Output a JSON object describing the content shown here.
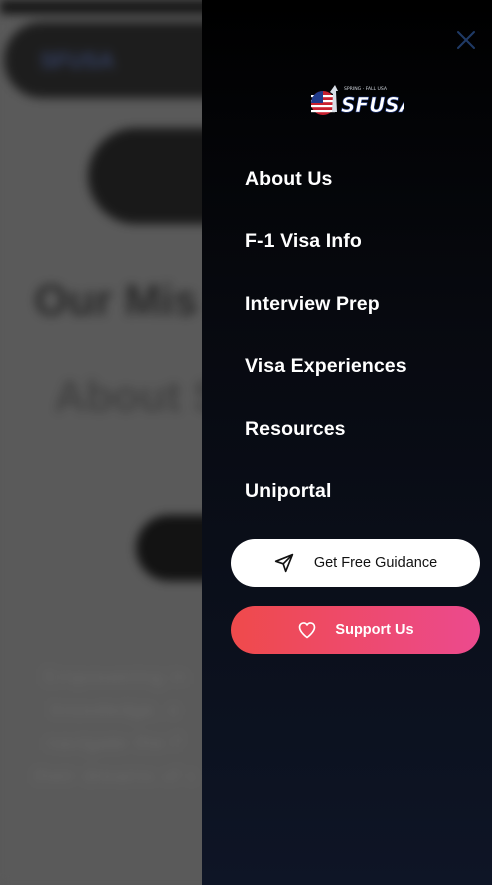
{
  "background": {
    "logo_text": "SFUSA",
    "heading_1": "Our Mis",
    "heading_2": "About S",
    "paragraph_lines": [
      "Empowering in",
      "knowledge, e",
      "navigate the F",
      "their dreams of s"
    ]
  },
  "drawer": {
    "close_icon": "close-icon",
    "brand": {
      "name": "SFUSA",
      "tagline": "SPRING · FALL USA"
    },
    "nav_items": [
      {
        "label": "About Us"
      },
      {
        "label": "F-1 Visa Info"
      },
      {
        "label": "Interview Prep"
      },
      {
        "label": "Visa Experiences"
      },
      {
        "label": "Resources"
      },
      {
        "label": "Uniportal"
      }
    ],
    "guidance_button": {
      "label": "Get Free Guidance",
      "icon": "send-icon"
    },
    "support_button": {
      "label": "Support Us",
      "icon": "heart-icon"
    }
  },
  "colors": {
    "drawer_top": "#000000",
    "drawer_bottom": "#0e1526",
    "support_gradient_start": "#ef4a4b",
    "support_gradient_end": "#ec4a8e",
    "close_icon": "#1f3a66"
  }
}
